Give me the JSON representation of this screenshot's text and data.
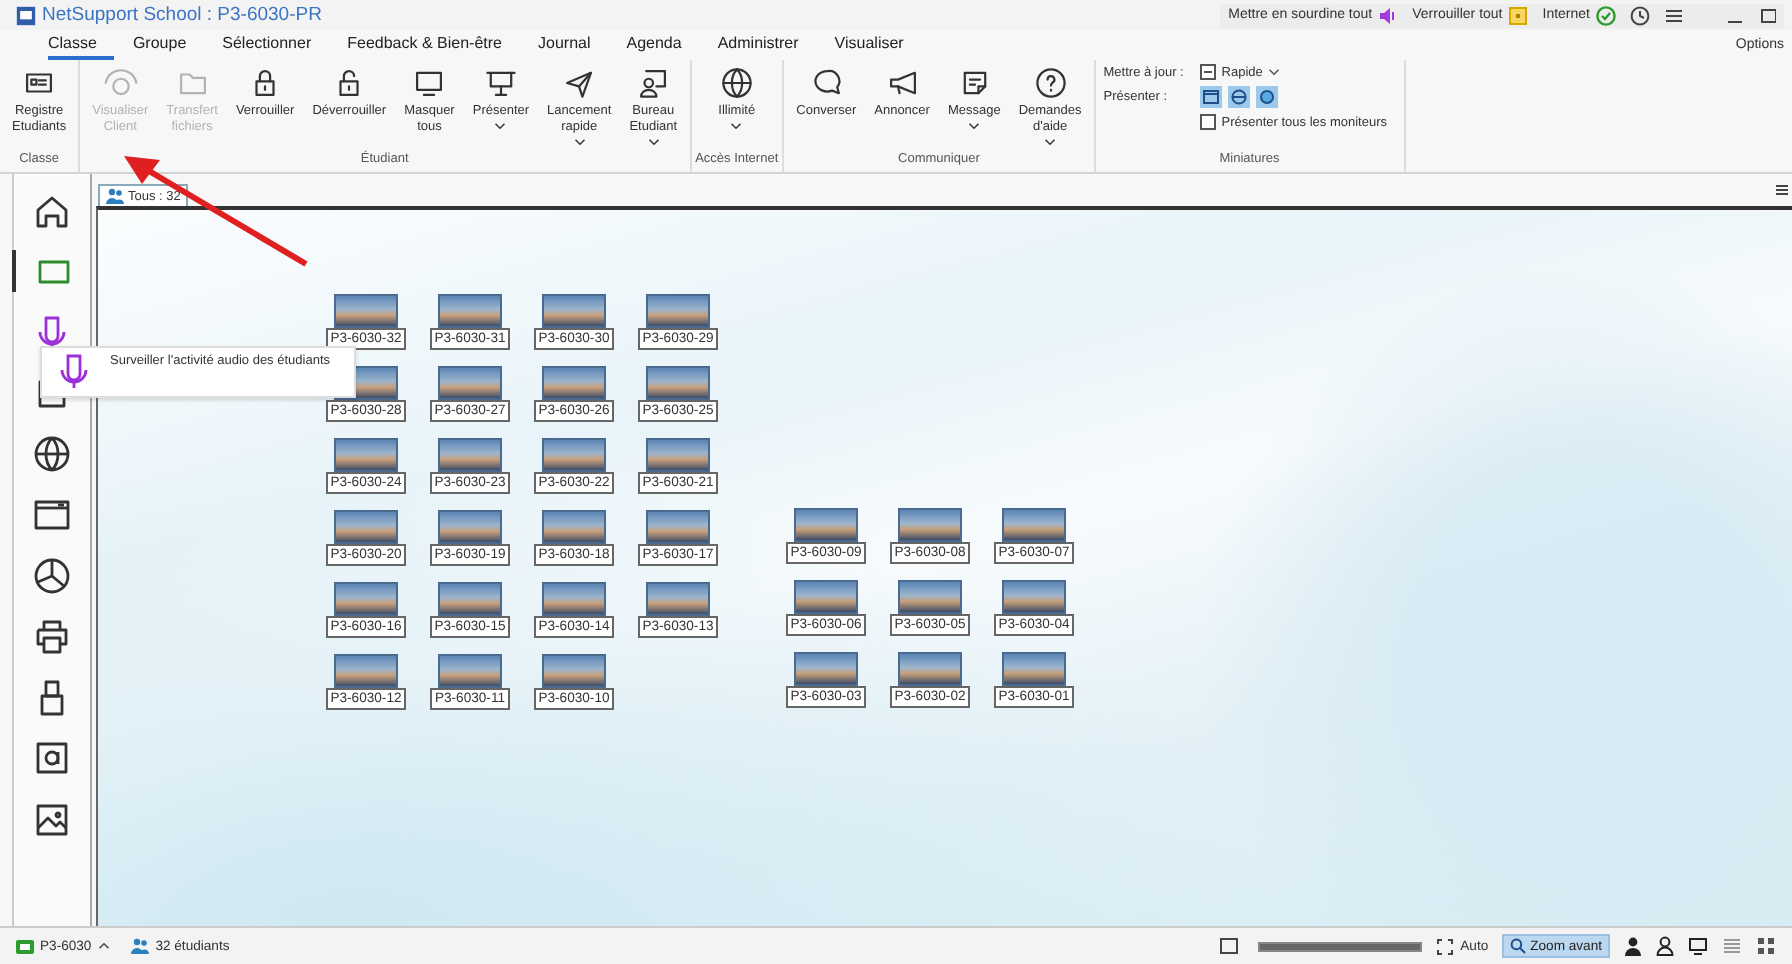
{
  "window": {
    "title": "NetSupport School : P3-6030-PR"
  },
  "top_status": [
    {
      "label": "Mettre en sourdine tout",
      "kind": "mute"
    },
    {
      "label": "Verrouiller tout",
      "kind": "lock"
    },
    {
      "label": "Internet",
      "kind": "internet"
    }
  ],
  "options_label": "Options",
  "menu_tabs": [
    {
      "label": "Classe",
      "selected": true
    },
    {
      "label": "Groupe",
      "selected": false
    },
    {
      "label": "Sélectionner",
      "selected": false
    },
    {
      "label": "Feedback & Bien-être",
      "selected": false
    },
    {
      "label": "Journal",
      "selected": false
    },
    {
      "label": "Agenda",
      "selected": false
    },
    {
      "label": "Administrer",
      "selected": false
    },
    {
      "label": "Visualiser",
      "selected": false
    }
  ],
  "ribbon_groups": [
    {
      "title": "Classe",
      "buttons": [
        {
          "label": "Registre\nEtudiants",
          "disabled": false,
          "has_menu": false
        }
      ]
    },
    {
      "title": "Étudiant",
      "buttons": [
        {
          "label": "Visualiser\nClient",
          "disabled": true,
          "has_menu": false
        },
        {
          "label": "Transfert\nfichiers",
          "disabled": true,
          "has_menu": false
        },
        {
          "label": "Verrouiller",
          "disabled": false,
          "has_menu": false
        },
        {
          "label": "Déverrouiller",
          "disabled": false,
          "has_menu": false
        },
        {
          "label": "Masquer\ntous",
          "disabled": false,
          "has_menu": false
        },
        {
          "label": "Présenter",
          "disabled": false,
          "has_menu": true
        },
        {
          "label": "Lancement\nrapide",
          "disabled": false,
          "has_menu": true
        },
        {
          "label": "Bureau\nEtudiant",
          "disabled": false,
          "has_menu": true
        }
      ]
    },
    {
      "title": "Accès Internet",
      "buttons": [
        {
          "label": "Illimité",
          "disabled": false,
          "has_menu": true
        }
      ]
    },
    {
      "title": "Communiquer",
      "buttons": [
        {
          "label": "Converser",
          "disabled": false,
          "has_menu": false
        },
        {
          "label": "Annoncer",
          "disabled": false,
          "has_menu": false
        },
        {
          "label": "Message",
          "disabled": false,
          "has_menu": true
        },
        {
          "label": "Demandes\nd'aide",
          "disabled": false,
          "has_menu": true
        }
      ]
    }
  ],
  "miniatures": {
    "title": "Miniatures",
    "update_label": "Mettre à jour :",
    "update_value": "Rapide",
    "present_label": "Présenter :",
    "show_all_monitors": {
      "label": "Présenter tous les moniteurs",
      "checked": false
    }
  },
  "sidebar": {
    "items": [
      {
        "selected": false
      },
      {
        "selected": true
      },
      {
        "selected": false
      },
      {
        "selected": false
      },
      {
        "selected": false
      },
      {
        "selected": false
      },
      {
        "selected": false
      },
      {
        "selected": false
      },
      {
        "selected": false
      },
      {
        "selected": false
      },
      {
        "selected": false
      }
    ],
    "tooltip": "Surveiller l'activité audio des étudiants"
  },
  "view_tab": {
    "label": "Tous : 32"
  },
  "monitor_groups": [
    {
      "rows": [
        [
          "P3-6030-32",
          "P3-6030-31",
          "P3-6030-30",
          "P3-6030-29"
        ],
        [
          "P3-6030-28",
          "P3-6030-27",
          "P3-6030-26",
          "P3-6030-25"
        ],
        [
          "P3-6030-24",
          "P3-6030-23",
          "P3-6030-22",
          "P3-6030-21"
        ],
        [
          "P3-6030-20",
          "P3-6030-19",
          "P3-6030-18",
          "P3-6030-17"
        ],
        [
          "P3-6030-16",
          "P3-6030-15",
          "P3-6030-14",
          "P3-6030-13"
        ],
        [
          "P3-6030-12",
          "P3-6030-11",
          "P3-6030-10"
        ]
      ]
    },
    {
      "rows": [
        [
          "P3-6030-09",
          "P3-6030-08",
          "P3-6030-07"
        ],
        [
          "P3-6030-06",
          "P3-6030-05",
          "P3-6030-04"
        ],
        [
          "P3-6030-03",
          "P3-6030-02",
          "P3-6030-01"
        ]
      ]
    }
  ],
  "status_bar": {
    "room": "P3-6030",
    "students": "32 étudiants",
    "zoom": {
      "level": 1
    },
    "auto_label": "Auto",
    "zoom_button": "Zoom avant"
  }
}
